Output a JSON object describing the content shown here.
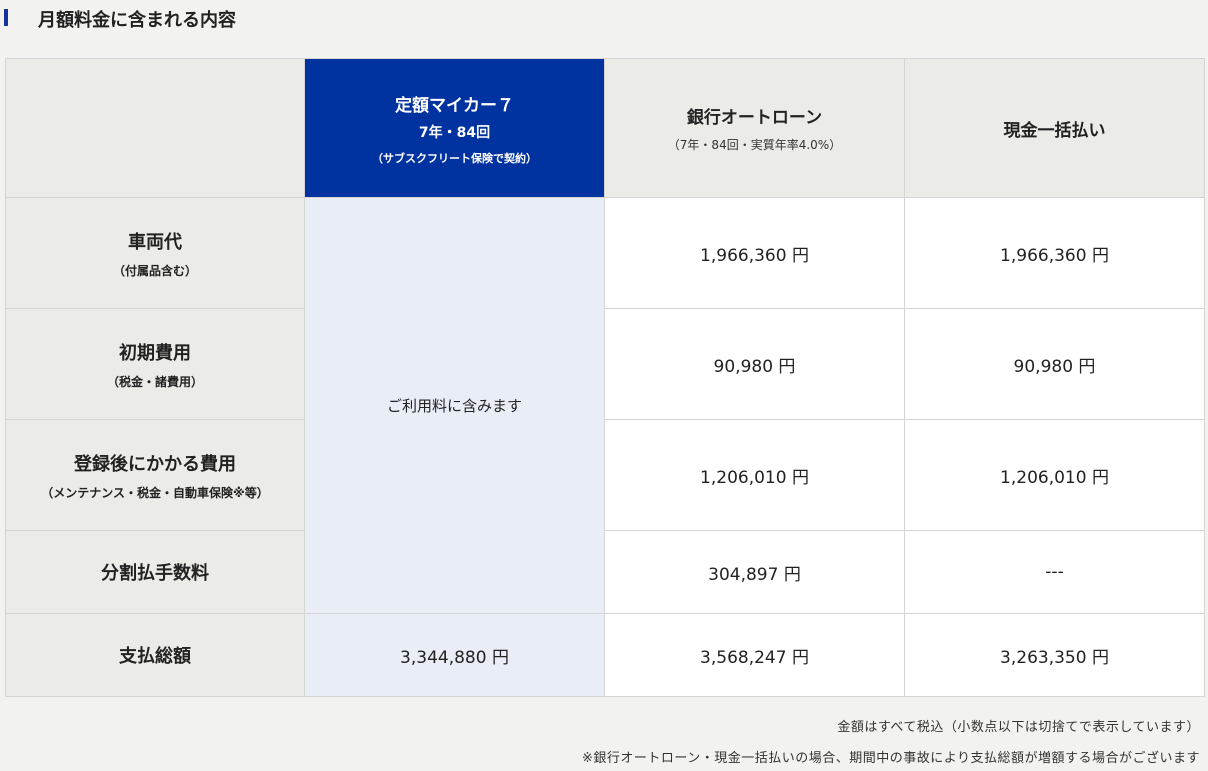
{
  "section": {
    "title": "月額料金に含まれる内容"
  },
  "columns": {
    "plan": {
      "name": "定額マイカー７",
      "term": "7年・84回",
      "note": "（サブスクフリート保険で契約）"
    },
    "loan": {
      "name": "銀行オートローン",
      "note": "（7年・84回・実質年率4.0%）"
    },
    "cash": {
      "name": "現金一括払い"
    }
  },
  "rows": {
    "vehicle": {
      "label": "車両代",
      "sub": "（付属品含む）",
      "loan": "1,966,360 円",
      "cash": "1,966,360 円"
    },
    "initial": {
      "label": "初期費用",
      "sub": "（税金・諸費用）",
      "loan": "90,980 円",
      "cash": "90,980 円"
    },
    "after": {
      "label": "登録後にかかる費用",
      "sub": "（メンテナンス・税金・自動車保険※等）",
      "loan": "1,206,010 円",
      "cash": "1,206,010 円"
    },
    "fee": {
      "label": "分割払手数料",
      "loan": "304,897 円",
      "cash": "---"
    },
    "total": {
      "label": "支払総額",
      "plan": "3,344,880 円",
      "loan": "3,568,247 円",
      "cash": "3,263,350 円"
    }
  },
  "plan_included_text": "ご利用料に含みます",
  "notes": {
    "tax": "金額はすべて税込（小数点以下は切捨てで表示しています）",
    "accident": "※銀行オートローン・現金一括払いの場合、期間中の事故により支払総額が増額する場合がございます"
  },
  "colors": {
    "accent": "#0033a0",
    "plan_cell_bg": "#e8edf6",
    "header_bg": "#ebebe8"
  }
}
